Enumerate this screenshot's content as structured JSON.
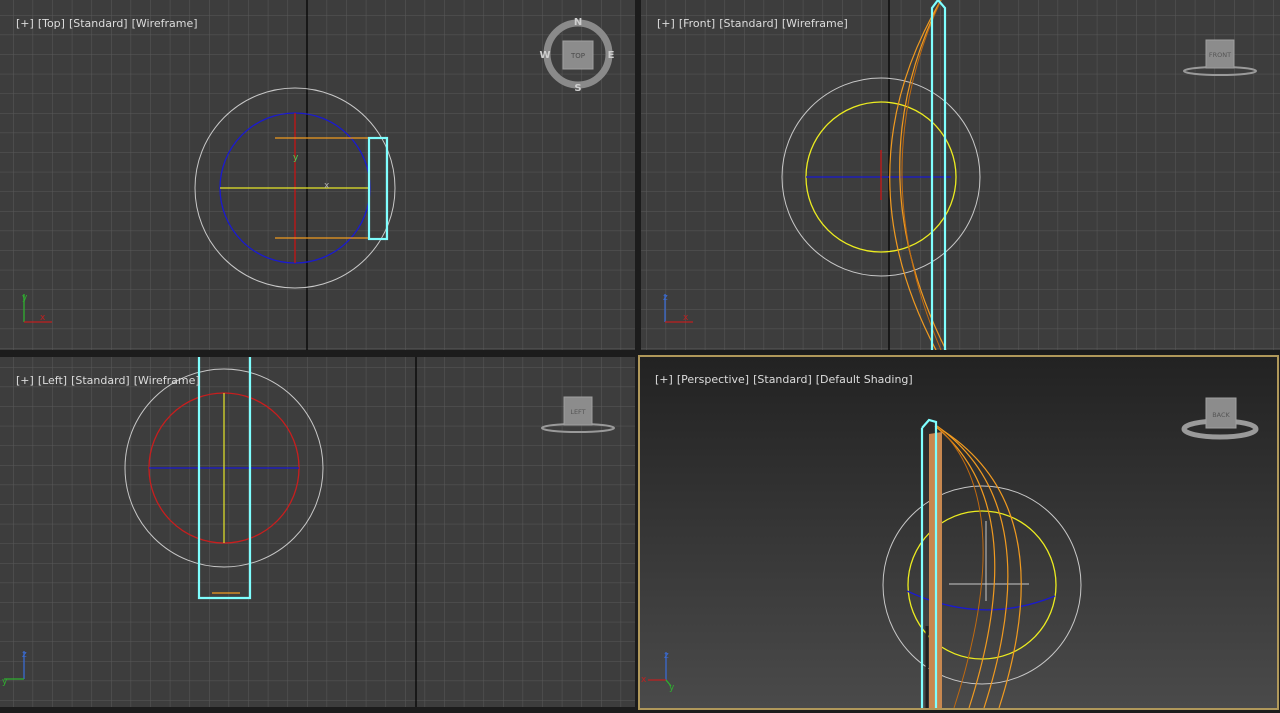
{
  "viewports": [
    {
      "id": "top",
      "labels": [
        "[+]",
        "[Top]",
        "[Standard]",
        "[Wireframe]"
      ],
      "cube_label": "TOP",
      "compass": [
        "N",
        "E",
        "S",
        "W"
      ],
      "axes": [
        "x",
        "y"
      ]
    },
    {
      "id": "front",
      "labels": [
        "[+]",
        "[Front]",
        "[Standard]",
        "[Wireframe]"
      ],
      "cube_label": "FRONT",
      "axes": [
        "x",
        "z"
      ]
    },
    {
      "id": "left",
      "labels": [
        "[+]",
        "[Left]",
        "[Standard]",
        "[Wireframe]"
      ],
      "cube_label": "LEFT",
      "axes": [
        "y",
        "z"
      ]
    },
    {
      "id": "perspective",
      "labels": [
        "[+]",
        "[Perspective]",
        "[Standard]",
        "[Default Shading]"
      ],
      "cube_label": "BACK",
      "axes": [
        "x",
        "y",
        "z"
      ],
      "active": true
    }
  ],
  "gizmo_labels": {
    "x": "x",
    "y": "y",
    "z": "z"
  },
  "colors": {
    "background_ortho": "#3d3d3d",
    "grid": "#585858",
    "grid_axis": "#000000",
    "selection": "#7fffff",
    "gizmo_outer": "#c8c8c8",
    "gizmo_blue": "#0000c8",
    "gizmo_red": "#c80000",
    "gizmo_yellow": "#ffff00",
    "orange_wire": "#f09a20",
    "active_border": "#b0985a"
  }
}
